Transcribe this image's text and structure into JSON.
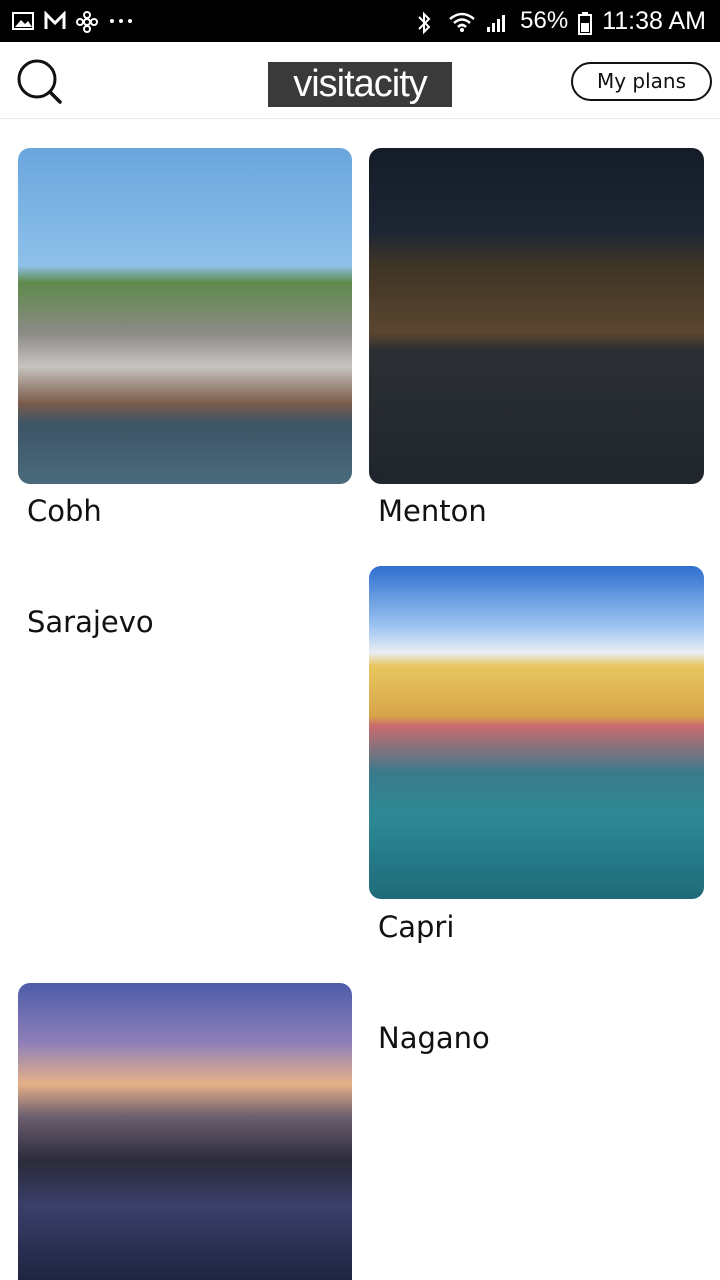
{
  "status_bar": {
    "notification_icons": [
      "gallery-icon",
      "gmail-icon",
      "fan-icon",
      "more-dots-icon"
    ],
    "battery": "56%",
    "time": "11:38 AM"
  },
  "header": {
    "logo_text": "visitacity",
    "plans_label": "My plans"
  },
  "cities": [
    {
      "name": "Cobh"
    },
    {
      "name": "Menton"
    },
    {
      "name": "Sarajevo"
    },
    {
      "name": "Capri"
    },
    {
      "name": "Nagano"
    }
  ]
}
